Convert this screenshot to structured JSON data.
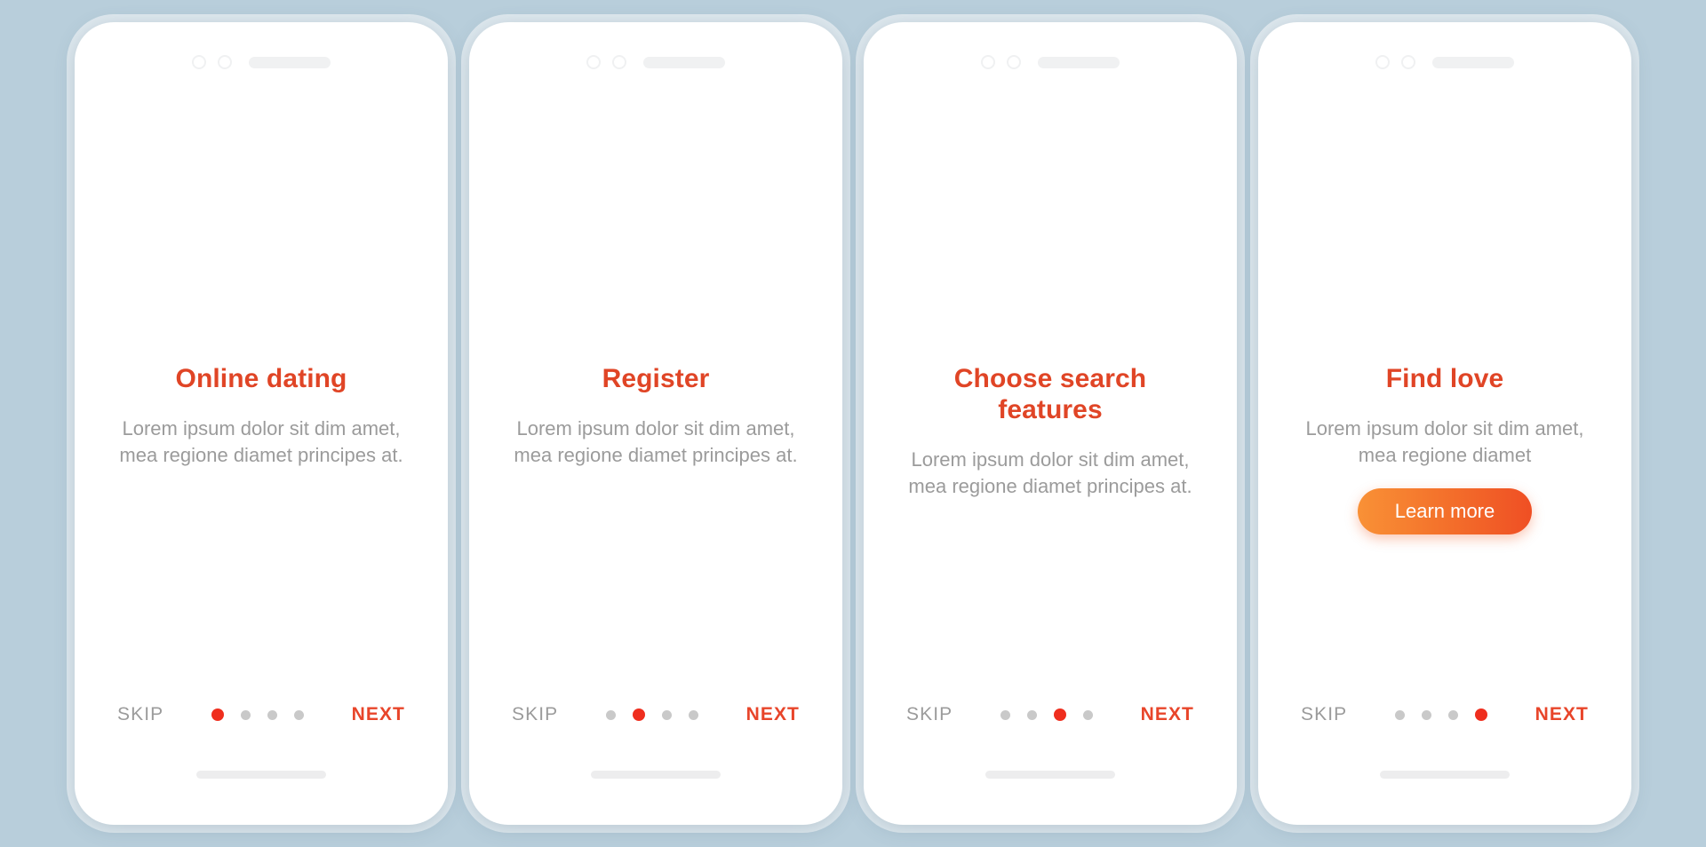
{
  "background_color": "#b8cedb",
  "accent_color": "#e04526",
  "muted_color": "#9b9b9b",
  "active_dot_color": "#ef2e1e",
  "inactive_dot_color": "#c9c9c9",
  "nav": {
    "skip_label": "SKIP",
    "next_label": "NEXT"
  },
  "screens": [
    {
      "title": "Online dating",
      "description": "Lorem ipsum dolor sit dim amet, mea regione diamet principes at.",
      "active_index": 0,
      "total_dots": 4,
      "illustration": "online-dating-monitor-heart-wifi",
      "has_cta": false,
      "cta_label": ""
    },
    {
      "title": "Register",
      "description": "Lorem ipsum dolor sit dim amet, mea regione diamet principes at.",
      "active_index": 1,
      "total_dots": 4,
      "illustration": "register-phone-profile-hand-email",
      "has_cta": false,
      "cta_label": ""
    },
    {
      "title": "Choose search features",
      "description": "Lorem ipsum dolor sit dim amet, mea regione diamet principes at.",
      "active_index": 2,
      "total_dots": 4,
      "illustration": "search-features-tablet-checklist-hand",
      "has_cta": false,
      "cta_label": ""
    },
    {
      "title": "Find love",
      "description": "Lorem ipsum dolor sit dim amet, mea regione diamet",
      "active_index": 3,
      "total_dots": 4,
      "illustration": "find-love-heart-key-bow-ring",
      "has_cta": true,
      "cta_label": "Learn more"
    }
  ]
}
